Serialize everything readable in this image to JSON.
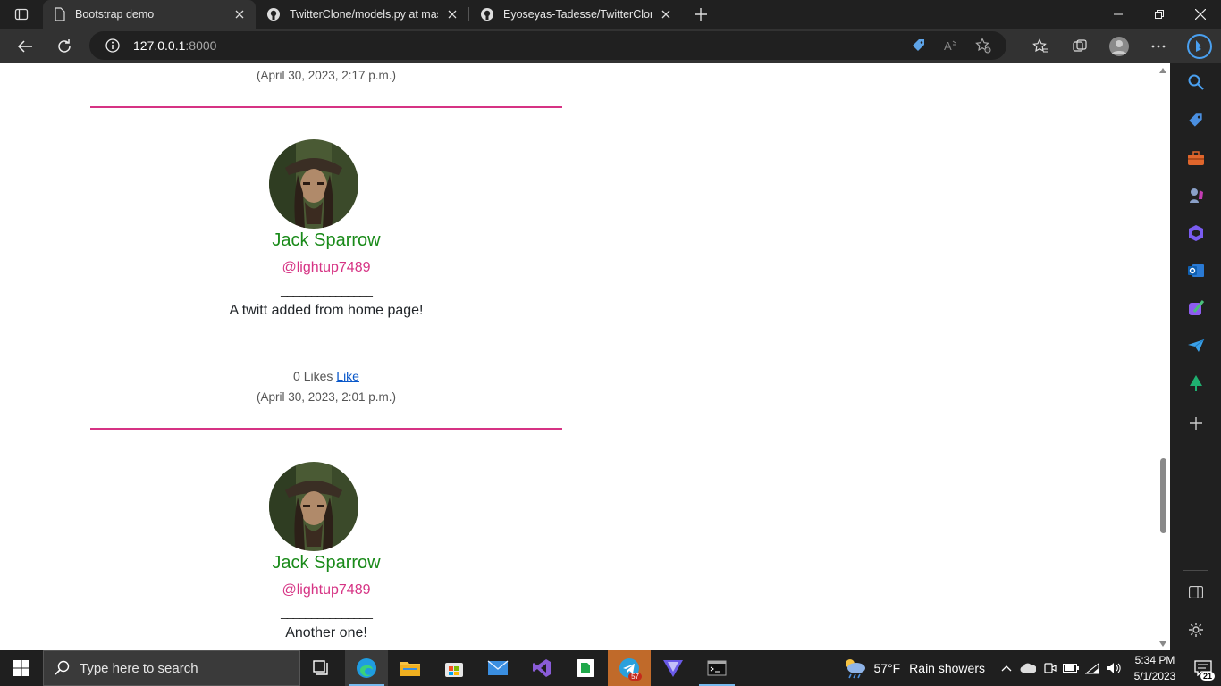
{
  "tabs": [
    {
      "title": "Bootstrap demo",
      "icon": "page-icon",
      "active": true
    },
    {
      "title": "TwitterClone/models.py at maste",
      "icon": "github-icon",
      "active": false
    },
    {
      "title": "Eyoseyas-Tadesse/TwitterClone: S",
      "icon": "github-icon",
      "active": false
    }
  ],
  "address": {
    "host": "127.0.0.1",
    "port": ":8000"
  },
  "page": {
    "top_date": "(April 30, 2023, 2:17 p.m.)",
    "posts": [
      {
        "name": "Jack Sparrow",
        "handle": "@lightup7489",
        "rule": "_______________",
        "body": "A twitt added from home page!",
        "likes_text": "0 Likes",
        "like_link": "Like",
        "date": "(April 30, 2023, 2:01 p.m.)"
      },
      {
        "name": "Jack Sparrow",
        "handle": "@lightup7489",
        "rule": "_______________",
        "body": "Another one!"
      }
    ]
  },
  "taskbar": {
    "search_placeholder": "Type here to search",
    "telegram_badge": "57",
    "weather_temp": "57°F",
    "weather_desc": "Rain showers",
    "time": "5:34 PM",
    "date": "5/1/2023",
    "notification_count": "21"
  },
  "colors": {
    "accent": "#d63384",
    "name": "#198a19",
    "link": "#0a58ca"
  }
}
